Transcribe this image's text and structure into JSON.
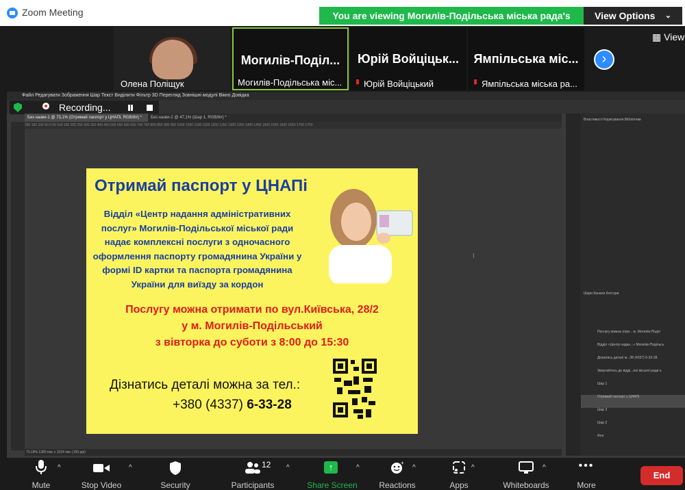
{
  "titlebar": {
    "app_title": "Zoom Meeting",
    "viewing_banner": "You are viewing Могилів-Подільська міська рада's screen",
    "view_options": "View Options"
  },
  "gallery": {
    "participants": [
      {
        "name_small": "Олена Поліщук",
        "name_big": ""
      },
      {
        "name_big": "Могилів-Поділ...",
        "name_small": "Могилів-Подільська міс..."
      },
      {
        "name_big": "Юрій Войціцьк...",
        "name_small": "Юрій Войціцький"
      },
      {
        "name_big": "Ямпільська міс...",
        "name_small": "Ямпільська міська ра..."
      }
    ],
    "view_label": "View"
  },
  "recording": {
    "label": "Recording..."
  },
  "photoshop": {
    "menu": "Файл  Редагувати  Зображення  Шар  Текст  Виділити  Фільтр  3D  Перегляд  Зовнішні модулі  Вікно  Довідка",
    "tab1": "Без назви-1 @ 73,1% (Отримай паспорт у ЦНАПі, RGB/8#) *",
    "tab2": "Без назви-2 @ 47,1% (Шар 1, RGB/8#) *",
    "status": "73,19%    1280 пікс х 1024 пікс (150 ppi)",
    "panel_tabs": "Властивості  Коригування  Бібліотеки",
    "layers_tab": "Шари  Канали  Контури",
    "layers": [
      "Послугу можна отри... м. Могилів-Поділ",
      "Відділ «Центр надан...» Могилів-Подільсь",
      "Дізнатись деталі м...38 (4337) 6-33-28",
      "Звертайтесь до відді...ної міської ради н",
      "Шар 1",
      "Отримай паспорт у ЦНАПі",
      "Шар 3",
      "Шар 2",
      "Фон"
    ]
  },
  "poster": {
    "title": "Отримай паспорт у ЦНАПі",
    "para": "Відділ «Центр надання адміністративних послуг» Могилів-Подільської міської ради надає комплексні послуги з одночасного оформлення паспорту громадянина України у формі ID картки та паспорта громадянина України для виїзду за кордон",
    "red_line1": "Послугу можна отримати по вул.Київська, 28/2",
    "red_line2": "у м. Могилів-Подільський",
    "red_line3": "з вівторка до суботи з 8:00 до 15:30",
    "details": "Дізнатись деталі можна за тел.:",
    "phone_prefix": "+380 (4337)",
    "phone_bold": "6-33-28"
  },
  "toolbar": {
    "mute": "Mute",
    "stop_video": "Stop Video",
    "security": "Security",
    "participants": "Participants",
    "participants_count": "12",
    "share_screen": "Share Screen",
    "reactions": "Reactions",
    "apps": "Apps",
    "whiteboards": "Whiteboards",
    "more": "More",
    "end": "End"
  },
  "colors": {
    "share_green": "#1fb84b",
    "zoom_blue": "#2d8cff",
    "end_red": "#d42b2b",
    "poster_yellow": "#fcf45f",
    "poster_blue": "#1b3f9e",
    "poster_red": "#e01b1b"
  }
}
